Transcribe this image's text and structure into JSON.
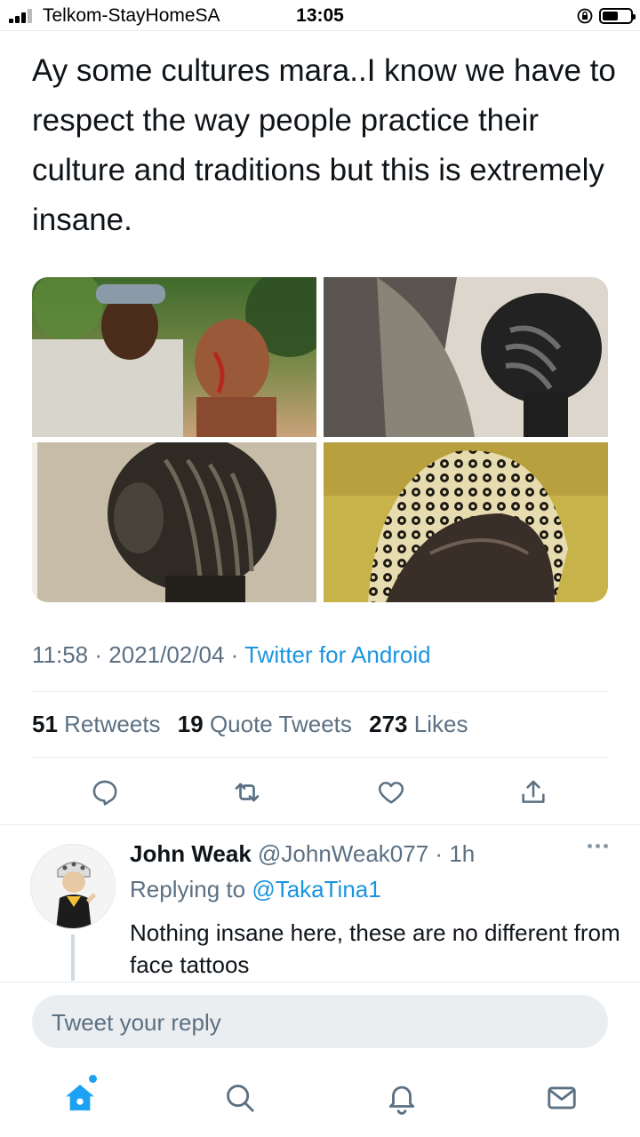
{
  "status_bar": {
    "carrier": "Telkom-StayHomeSA",
    "time": "13:05",
    "battery_level": 0.55
  },
  "tweet": {
    "text": "Ay some cultures mara..I know we have to respect the way people practice their culture and traditions but this is extremely insane.",
    "time": "11:58",
    "date": "2021/02/04",
    "separator": "·",
    "source": "Twitter for Android",
    "stats": {
      "retweets_count": "51",
      "retweets_label": "Retweets",
      "quotes_count": "19",
      "quotes_label": "Quote Tweets",
      "likes_count": "273",
      "likes_label": "Likes"
    },
    "actions": [
      "reply-icon",
      "retweet-icon",
      "like-icon",
      "share-icon"
    ]
  },
  "reply": {
    "name": "John Weak",
    "handle": "@JohnWeak077",
    "separator": "·",
    "age": "1h",
    "replying_prefix": "Replying to",
    "replying_to": "@TakaTina1",
    "text": "Nothing insane here, these are no different from face tattoos"
  },
  "composer": {
    "placeholder": "Tweet your reply"
  },
  "tab_bar": [
    "home-icon",
    "search-icon",
    "notifications-icon",
    "messages-icon"
  ],
  "colors": {
    "accent": "#1da1f2",
    "link": "#1b95e0",
    "muted": "#5b7083"
  }
}
